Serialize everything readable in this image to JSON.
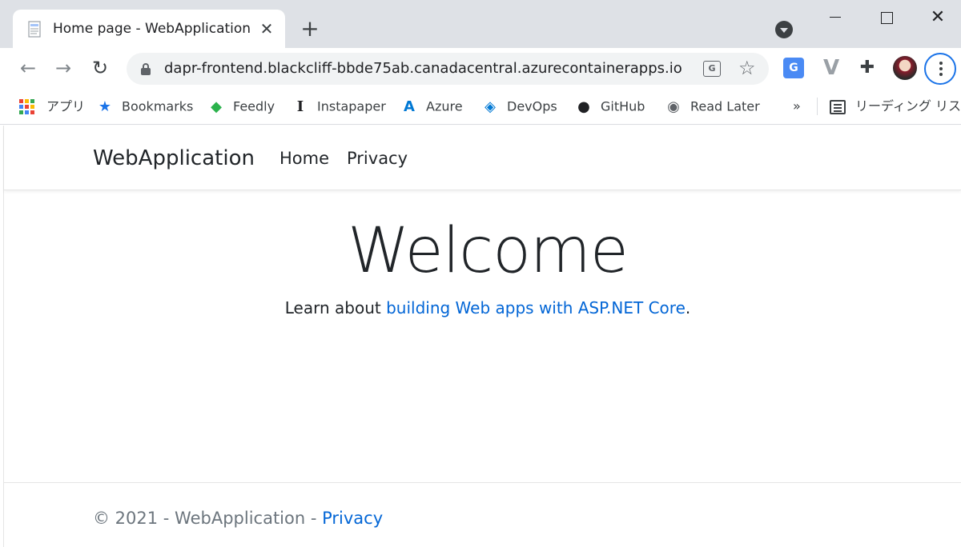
{
  "tab": {
    "title": "Home page - WebApplication",
    "close": "✕",
    "new_tab": "+"
  },
  "window": {
    "close": "✕"
  },
  "toolbar": {
    "back": "←",
    "forward": "→",
    "reload": "↻",
    "url": "dapr-frontend.blackcliff-bbde75ab.canadacentral.azurecontainerapps.io",
    "translate_glyph": "G",
    "star": "☆",
    "ext_translate": "G",
    "ext_v": "V",
    "ext_puzzle": "✚"
  },
  "bookmarks": {
    "items": [
      {
        "label": "アプリ",
        "icon": "apps-grid-icon"
      },
      {
        "label": "Bookmarks",
        "icon": "star-icon"
      },
      {
        "label": "Feedly",
        "icon": "feedly-icon"
      },
      {
        "label": "Instapaper",
        "icon": "instapaper-icon"
      },
      {
        "label": "Azure",
        "icon": "azure-icon"
      },
      {
        "label": "DevOps",
        "icon": "devops-icon"
      },
      {
        "label": "GitHub",
        "icon": "github-icon"
      },
      {
        "label": "Read Later",
        "icon": "globe-icon"
      }
    ],
    "more": "»",
    "reading_list": "リーディング リスト"
  },
  "page": {
    "brand": "WebApplication",
    "nav": {
      "home": "Home",
      "privacy": "Privacy"
    },
    "heading": "Welcome",
    "learn_prefix": "Learn about ",
    "learn_link": "building Web apps with ASP.NET Core",
    "learn_suffix": ".",
    "footer_prefix": "© 2021 - WebApplication - ",
    "footer_link": "Privacy"
  },
  "colors": {
    "link": "#0366d6",
    "accent": "#1a73e8",
    "tabstrip": "#dee1e6"
  }
}
